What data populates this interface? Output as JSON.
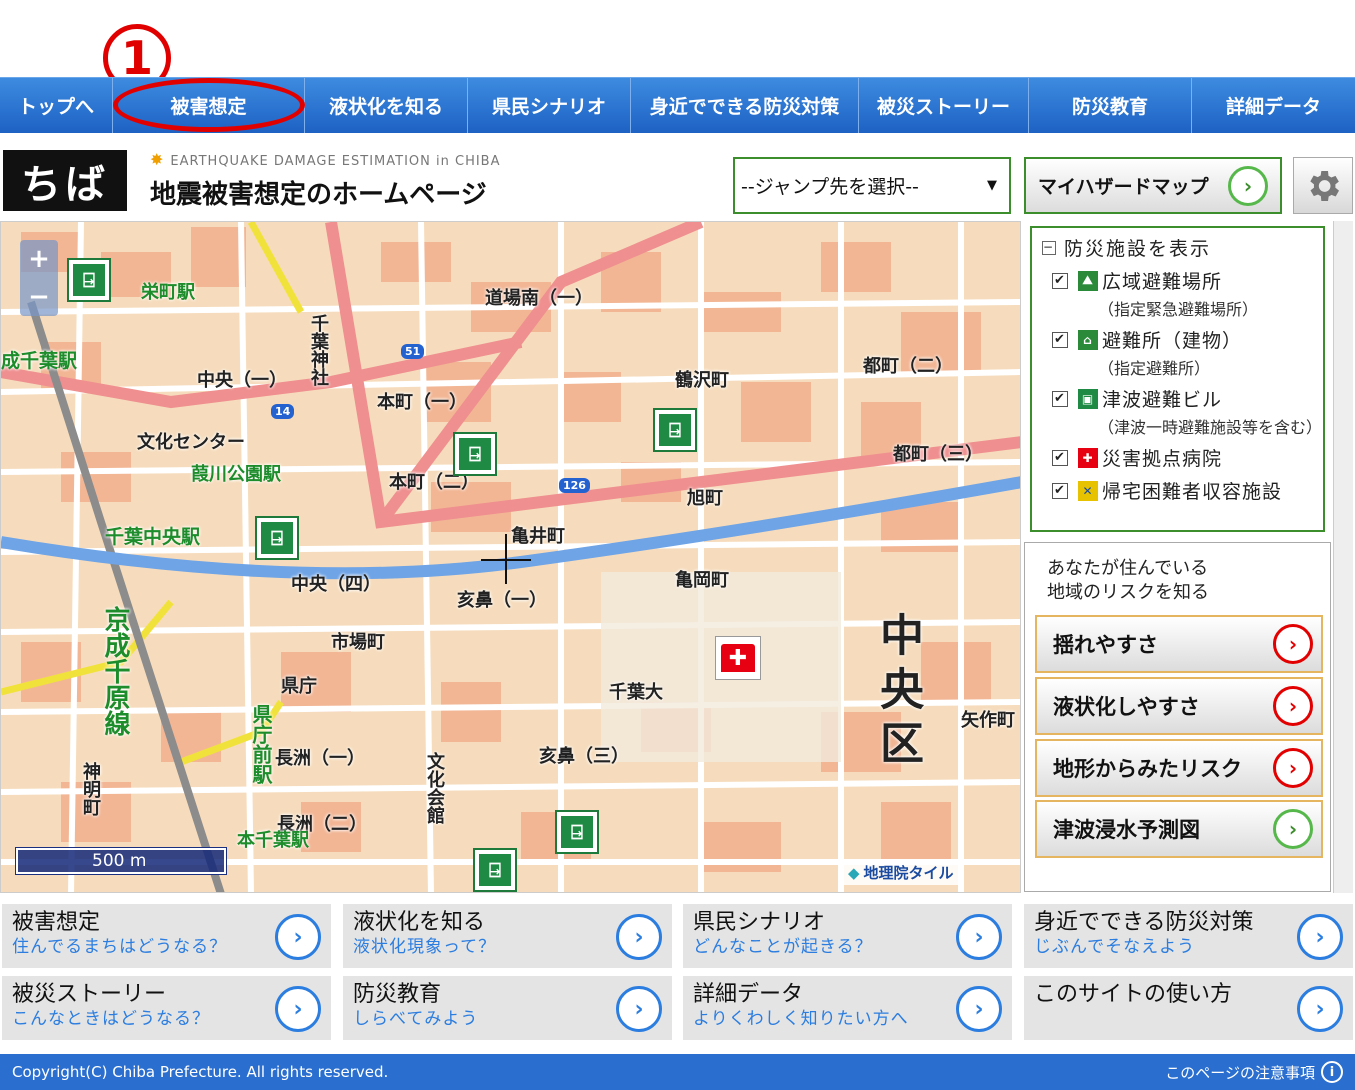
{
  "annotation": {
    "number": "1"
  },
  "nav": {
    "items": [
      "トップへ",
      "被害想定",
      "液状化を知る",
      "県民シナリオ",
      "身近でできる防災対策",
      "被災ストーリー",
      "防災教育",
      "詳細データ"
    ]
  },
  "header": {
    "logo": "ちば",
    "subtitle_en": "EARTHQUAKE DAMAGE ESTIMATION in CHIBA",
    "title": "地震被害想定のホームページ",
    "jump_select": "--ジャンプ先を選択--",
    "myhazard": "マイハザードマップ"
  },
  "map": {
    "scale": "500 m",
    "attribution": "地理院タイル",
    "labels": {
      "sakaecho_st": "栄町駅",
      "chiba_st": "成千葉駅",
      "chuo1": "中央（一）",
      "chiba_jinja": "千葉神社",
      "honcho1": "本町（一）",
      "honcho2": "本町（二）",
      "dojominami": "道場南（一）",
      "tsurusawa": "鶴沢町",
      "miyakocho2": "都町（二）",
      "miyakocho3": "都町（三）",
      "asahicho": "旭町",
      "kameicho": "亀井町",
      "kameokacho": "亀岡町",
      "bunka_center": "文化センター",
      "hashikawa_koen": "葭川公園駅",
      "chiba_chuo_st": "千葉中央駅",
      "chuo4": "中央（四）",
      "ichibacho": "市場町",
      "inohana1": "亥鼻（一）",
      "inohana3": "亥鼻（三）",
      "chiba_dai": "千葉大",
      "kencho": "県庁",
      "nagasu1": "長洲（一）",
      "nagasu2": "長洲（二）",
      "kenchomae": "県庁前駅",
      "honchiba": "本千葉駅",
      "keisei": "京成千原線",
      "bunka_kaikan": "文化会館",
      "chuo_ku": "中央区",
      "yasakucho": "矢作町",
      "jinmyocho": "神明町",
      "route51": "51",
      "route14": "14",
      "route126": "126"
    }
  },
  "facilities": {
    "header": "防災施設を表示",
    "items": [
      {
        "label": "広域避難場所",
        "sub": "（指定緊急避難場所）",
        "color": "#2a8a3a"
      },
      {
        "label": "避難所（建物）",
        "sub": "（指定避難所）",
        "color": "#2a8a3a"
      },
      {
        "label": "津波避難ビル",
        "sub": "（津波一時避難施設等を含む）",
        "color": "#1e8a43"
      },
      {
        "label": "災害拠点病院",
        "sub": "",
        "color": "#e60012"
      },
      {
        "label": "帰宅困難者収容施設",
        "sub": "",
        "color": "#e6c200"
      }
    ]
  },
  "risk": {
    "intro_line1": "あなたが住んでいる",
    "intro_line2": "地域のリスクを知る",
    "buttons": [
      "揺れやすさ",
      "液状化しやすさ",
      "地形からみたリスク",
      "津波浸水予測図"
    ]
  },
  "tiles": [
    {
      "title": "被害想定",
      "sub": "住んでるまちはどうなる？"
    },
    {
      "title": "液状化を知る",
      "sub": "液状化現象って？"
    },
    {
      "title": "県民シナリオ",
      "sub": "どんなことが起きる？"
    },
    {
      "title": "身近でできる防災対策",
      "sub": "じぶんでそなえよう"
    },
    {
      "title": "被災ストーリー",
      "sub": "こんなときはどうなる？"
    },
    {
      "title": "防災教育",
      "sub": "しらべてみよう"
    },
    {
      "title": "詳細データ",
      "sub": "よりくわしく知りたい方へ"
    },
    {
      "title": "このサイトの使い方",
      "sub": ""
    }
  ],
  "footer": {
    "copyright": "Copyright(C) Chiba Prefecture. All rights reserved.",
    "note": "このページの注意事項"
  },
  "colors": {
    "nav_blue": "#2a6fcf",
    "accent_green": "#3b8e2b",
    "accent_red": "#e20000",
    "link_blue": "#2b7de0"
  }
}
